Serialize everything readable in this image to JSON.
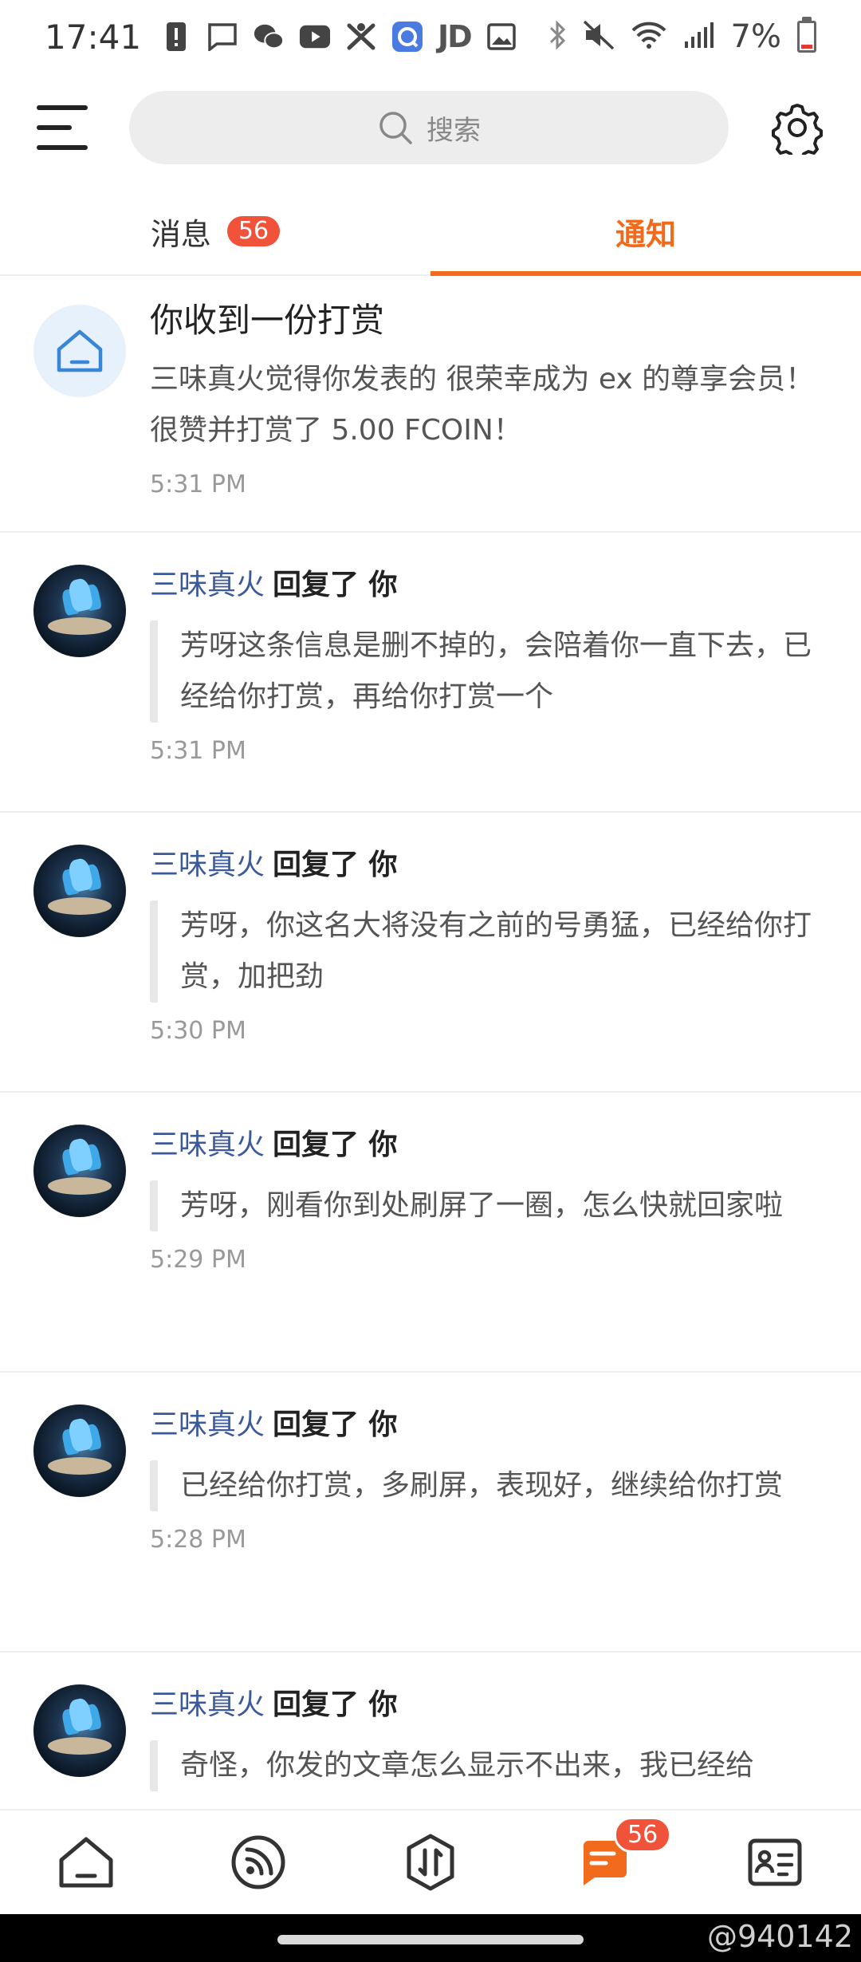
{
  "status_bar": {
    "time": "17:41",
    "jd_label": "JD",
    "battery_text": "7%"
  },
  "header": {
    "search_placeholder": "搜索"
  },
  "tabs": [
    {
      "label": "消息",
      "badge": "56",
      "active": false
    },
    {
      "label": "通知",
      "active": true
    }
  ],
  "notifications": {
    "system": {
      "icon": "house-icon",
      "title": "你收到一份打赏",
      "body": "三味真火觉得你发表的 很荣幸成为 ex 的尊享会员！ 很赞并打赏了 5.00 FCOIN！",
      "time": "5:31 PM"
    },
    "replies": [
      {
        "user": "三味真火",
        "action": "回复了 你",
        "text": "芳呀这条信息是删不掉的，会陪着你一直下去，已经给你打赏，再给你打赏一个",
        "time": "5:31 PM"
      },
      {
        "user": "三味真火",
        "action": "回复了 你",
        "text": "芳呀，你这名大将没有之前的号勇猛，已经给你打赏，加把劲",
        "time": "5:30 PM"
      },
      {
        "user": "三味真火",
        "action": "回复了 你",
        "text": "芳呀，刚看你到处刷屏了一圈，怎么快就回家啦",
        "time": "5:29 PM"
      },
      {
        "user": "三味真火",
        "action": "回复了 你",
        "text": "已经给你打赏，多刷屏，表现好，继续给你打赏",
        "time": "5:28 PM"
      },
      {
        "user": "三味真火",
        "action": "回复了 你",
        "text": "奇怪，你发的文章怎么显示不出来，我已经给",
        "time": ""
      }
    ]
  },
  "bottom_nav": {
    "items": [
      "home-icon",
      "feed-icon",
      "trade-icon",
      "messages-icon",
      "profile-card-icon"
    ],
    "messages_badge": "56",
    "accent_color": "#f26b1d"
  },
  "watermark": "@940142"
}
